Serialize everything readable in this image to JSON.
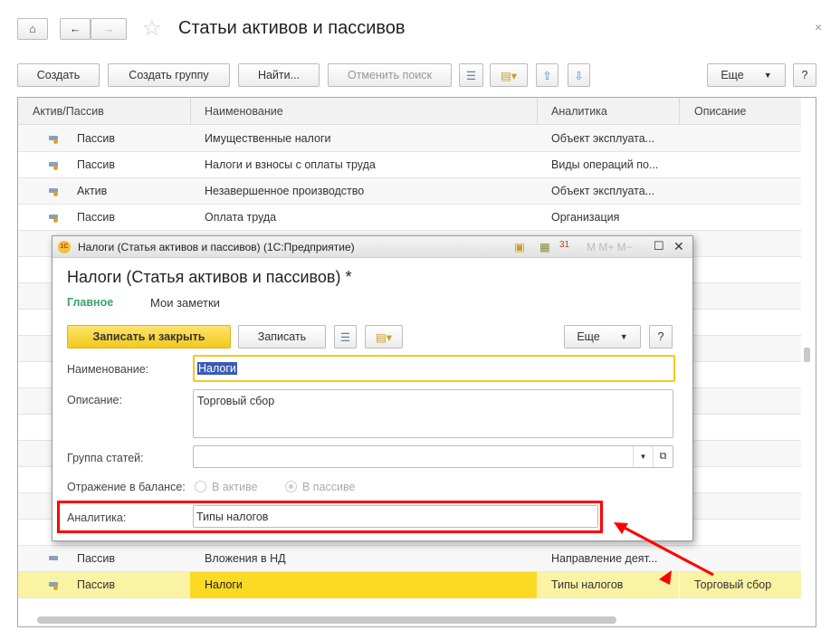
{
  "window": {
    "title": "Статьи активов и пассивов",
    "close": "×"
  },
  "toolbar": {
    "create": "Создать",
    "create_group": "Создать группу",
    "find": "Найти...",
    "cancel_search": "Отменить поиск",
    "more": "Еще",
    "help": "?"
  },
  "table": {
    "columns": [
      "Актив/Пассив",
      "Наименование",
      "Аналитика",
      "Описание"
    ],
    "rows": [
      {
        "type": "Пассив",
        "name": "Имущественные налоги",
        "analytics": "Объект эксплуата...",
        "desc": ""
      },
      {
        "type": "Пассив",
        "name": "Налоги и взносы с оплаты труда",
        "analytics": "Виды операций по...",
        "desc": ""
      },
      {
        "type": "Актив",
        "name": "Незавершенное производство",
        "analytics": "Объект эксплуата...",
        "desc": ""
      },
      {
        "type": "Пассив",
        "name": "Оплата труда",
        "analytics": "Организация",
        "desc": ""
      },
      {
        "type": "Пассив",
        "name": "Вложения в НД",
        "analytics": "Направление деят...",
        "desc": ""
      },
      {
        "type": "Пассив",
        "name": "Налоги",
        "analytics": "Типы налогов",
        "desc": "Торговый сбор"
      }
    ]
  },
  "dialog": {
    "window_title": "Налоги (Статья активов и пассивов)  (1С:Предприятие)",
    "heading": "Налоги (Статья активов и пассивов) *",
    "tabs": [
      "Главное",
      "Мои заметки"
    ],
    "save_close": "Записать и закрыть",
    "save": "Записать",
    "more": "Еще",
    "help": "?",
    "tb_icons": "M M+ M−",
    "name_label": "Наименование:",
    "name_value": "Налоги",
    "desc_label": "Описание:",
    "desc_value": "Торговый сбор",
    "group_label": "Группа статей:",
    "group_value": "",
    "balance_label": "Отражение в балансе:",
    "opt_active": "В активе",
    "opt_passive": "В пассиве",
    "analytics_label": "Аналитика:",
    "analytics_value": "Типы налогов"
  },
  "colors": {
    "accent_green": "#3aa36a",
    "highlight": "#fada22",
    "annotation_red": "#ff0000"
  }
}
